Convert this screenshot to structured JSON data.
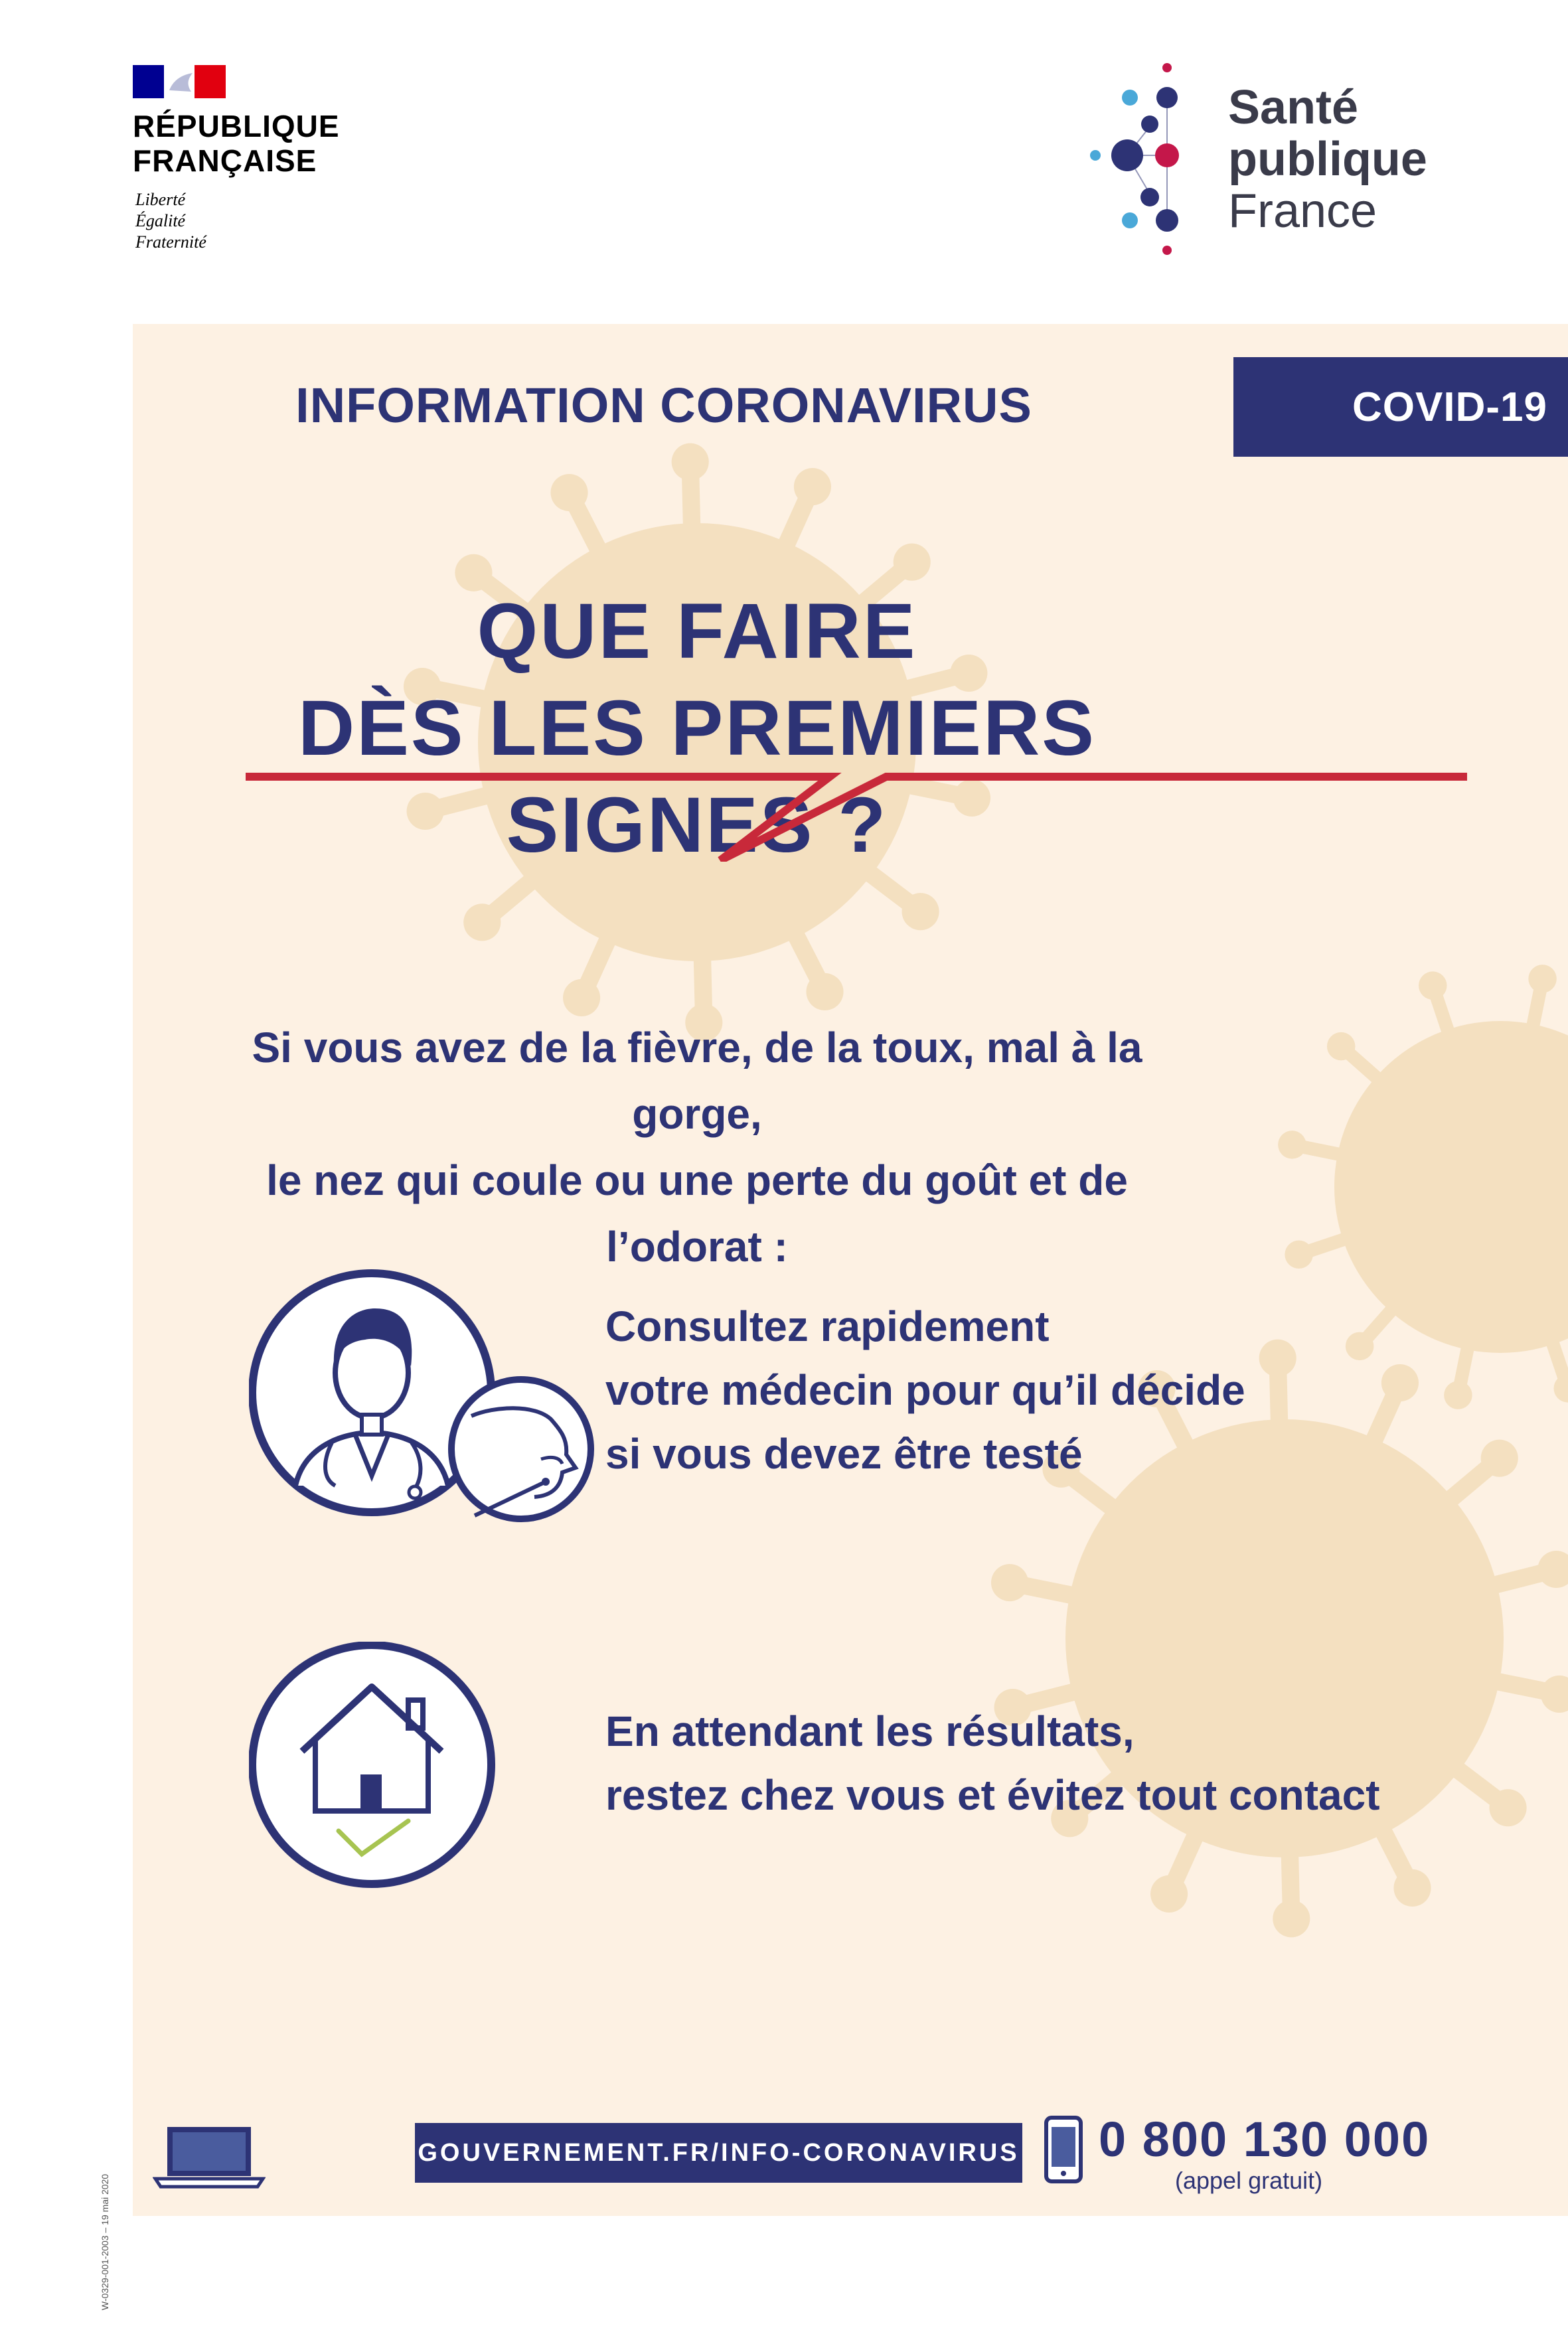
{
  "header": {
    "republic": {
      "line1": "RÉPUBLIQUE",
      "line2": "FRANÇAISE",
      "motto": [
        "Liberté",
        "Égalité",
        "Fraternité"
      ]
    },
    "agency": {
      "line1": "Santé",
      "line2": "publique",
      "line3": "France"
    }
  },
  "panel": {
    "kicker": "INFORMATION CORONAVIRUS",
    "badge": "COVID-19",
    "title_line1": "QUE FAIRE",
    "title_line2": "DÈS LES PREMIERS SIGNES ?",
    "symptoms_line1": "Si vous avez de la fièvre, de la toux, mal à la gorge,",
    "symptoms_line2": "le nez qui coule ou une perte du goût et de l’odorat :",
    "steps": [
      {
        "icon": "doctor-test-icon",
        "lines": [
          "Consultez rapidement",
          "votre médecin pour qu’il décide",
          "si vous devez être testé"
        ]
      },
      {
        "icon": "house-check-icon",
        "lines": [
          "En attendant les résultats,",
          "restez chez vous et évitez tout contact"
        ]
      }
    ]
  },
  "footer": {
    "website": "GOUVERNEMENT.FR/INFO-CORONAVIRUS",
    "phone": "0 800 130 000",
    "phone_note": "(appel gratuit)",
    "doc_ref": "W-0329-001-2003 – 19 mai 2020"
  },
  "colors": {
    "navy": "#2d3375",
    "accent_red": "#c8293a",
    "panel_bg": "#fdf1e3",
    "virus": "#f4e0c0",
    "check_green": "#a7c451",
    "spf_light_blue": "#4aa8d8",
    "spf_magenta": "#c4174a"
  }
}
